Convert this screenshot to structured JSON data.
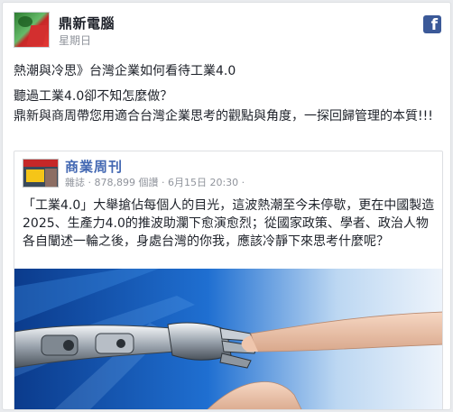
{
  "post": {
    "page_name": "鼎新電腦",
    "time": "星期日",
    "message": [
      "熱潮與冷思》台灣企業如何看待工業4.0",
      "聽過工業4.0卻不知怎麼做？",
      "鼎新與商周帶您用適合台灣企業思考的觀點與角度，一探回歸管理的本質!!!"
    ]
  },
  "link_card": {
    "source_name": "商業周刊",
    "meta": "雜誌 · 878,899 個讚 · 6月15日 20:30 ·",
    "text": "「工業4.0」大舉搶佔每個人的目光，這波熱潮至今未停歇，更在中國製造2025、生產力4.0的推波助瀾下愈演愈烈；從國家政策、學者、政治人物各自闡述一輪之後，身處台灣的你我，應該冷靜下來思考什麼呢？"
  },
  "icons": {
    "avatar": "page-avatar",
    "facebook": "facebook-f-icon",
    "image": "robot-human-handshake"
  },
  "colors": {
    "link_blue": "#4267b2",
    "fb_blue": "#3b5998",
    "muted": "#90949c"
  }
}
